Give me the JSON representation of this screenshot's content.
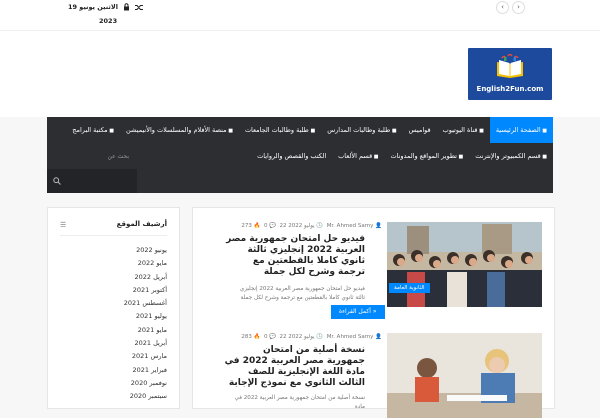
{
  "topbar": {
    "date": "الاثنين يونيو 19",
    "year": "2023",
    "prev_label": "‹",
    "next_label": "›",
    "lock_icon": "lock-icon",
    "shuffle_icon": "shuffle-icon"
  },
  "logo": {
    "text": "English2Fun.com",
    "bg": "#1d4a9c"
  },
  "nav": {
    "row1": [
      {
        "label": "الصفحة الرئيسية",
        "icon": "home-icon",
        "active": true
      },
      {
        "label": "قناة اليوتيوب",
        "icon": "youtube-icon"
      },
      {
        "label": "قواميس"
      },
      {
        "label": "طلبة وطالبات المدارس",
        "icon": "school-icon"
      },
      {
        "label": "طلبة وطالبات الجامعات",
        "icon": "university-icon"
      },
      {
        "label": "منصة الأفلام والمسلسلات والأنيميشن",
        "icon": "video-icon"
      },
      {
        "label": "مكتبة البرامج",
        "icon": "software-icon"
      }
    ],
    "row2": [
      {
        "label": "قسم الكمبيوتر والإنترنت",
        "icon": "computer-icon"
      },
      {
        "label": "تطوير المواقع والمدونات",
        "icon": "code-icon"
      },
      {
        "label": "قسم الألعاب",
        "icon": "games-icon"
      },
      {
        "label": "الكتب والقصص والروايات"
      }
    ],
    "search_placeholder": "بحث عن",
    "accent": "#0088ff"
  },
  "sidebar": {
    "title": "أرشيف الموقع",
    "archive": [
      "يونيو 2022",
      "مايو 2022",
      "أبريل 2022",
      "أكتوبر 2021",
      "أغسطس 2021",
      "يوليو 2021",
      "مايو 2021",
      "أبريل 2021",
      "مارس 2021",
      "فبراير 2021",
      "نوفمبر 2020",
      "سبتمبر 2020"
    ]
  },
  "posts": [
    {
      "author": "Mr. Ahmed Samy",
      "date": "22 يوليو 2022",
      "comments": "0",
      "views": "273",
      "title": "فيديو حل امتحان جمهورية مصر العربية 2022 إنجليزي ثالثة ثانوي كاملا بالقطعتين مع ترجمة وشرح لكل جملة",
      "excerpt": "فيديو حل امتحان جمهورية مصر العربية 2022 إنجليزي ثالثة ثانوي كاملا بالقطعتين مع ترجمة وشرح لكل جملة",
      "badge": "الثانوية العامة",
      "more": "أكمل القراءة »"
    },
    {
      "author": "Mr. Ahmed Samy",
      "date": "22 يوليو 2022",
      "comments": "0",
      "views": "283",
      "title": "نسخة أصلية من امتحان جمهورية مصر العربية 2022 في مادة اللغة الإنجليزية للصف الثالث الثانوي مع نموذج الإجابة",
      "excerpt": "نسخة أصلية من امتحان جمهورية مصر العربية 2022 في مادة"
    }
  ]
}
